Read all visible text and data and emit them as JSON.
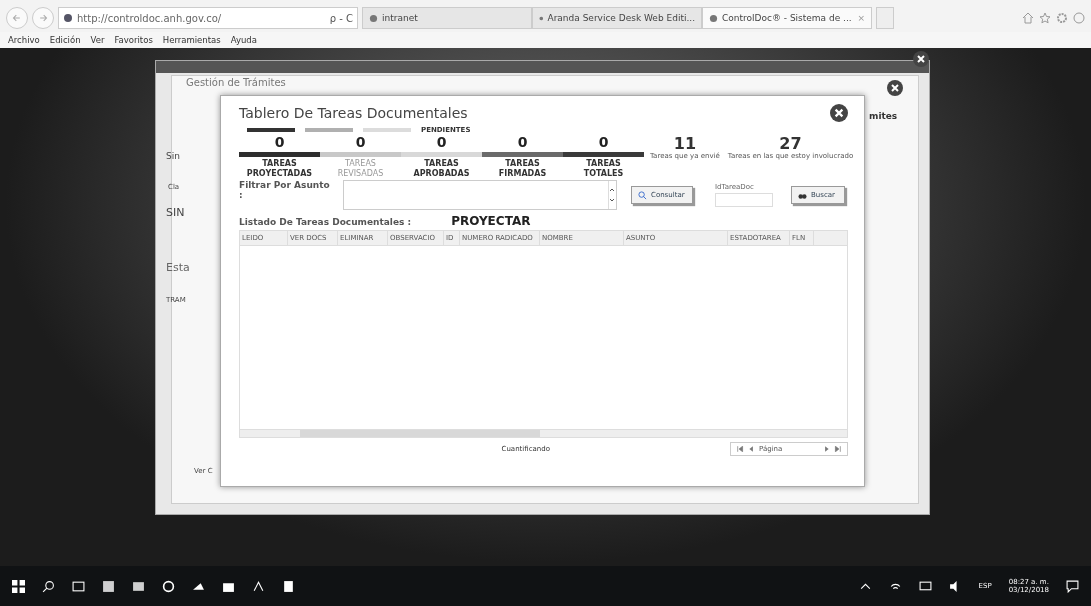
{
  "browser": {
    "address": "http://controldoc.anh.gov.co/",
    "address_actions": "ρ - C",
    "tabs": [
      {
        "label": "intranet",
        "selected": false
      },
      {
        "label": "Aranda Service Desk Web Editi...",
        "selected": false
      },
      {
        "label": "ControlDoc® - Sistema de ...",
        "selected": true,
        "close": "×"
      }
    ],
    "menu": [
      "Archivo",
      "Edición",
      "Ver",
      "Favoritos",
      "Herramientas",
      "Ayuda"
    ]
  },
  "background_page": {
    "title": "Gestión de Trámites",
    "fragments": [
      "Sin",
      "Cla",
      "SIN",
      "Esta",
      "TRAM",
      "Ver C",
      "mites"
    ]
  },
  "dialog": {
    "title": "Tablero De Tareas Documentales",
    "legend": {
      "swatches": [
        {
          "color": "#333333"
        },
        {
          "color": "#b0b0b0"
        },
        {
          "color": "#dcdcdc"
        }
      ],
      "label": "PENDIENTES"
    },
    "counters": [
      {
        "count": "0",
        "label": "TAREAS PROYECTADAS",
        "color": "#2e2e2e",
        "disabled": false
      },
      {
        "count": "0",
        "label": "TAREAS REVISADAS",
        "color": "#c8c8c8",
        "disabled": true
      },
      {
        "count": "0",
        "label": "TAREAS APROBADAS",
        "color": "#d8d8d8",
        "disabled": false
      },
      {
        "count": "0",
        "label": "TAREAS FIRMADAS",
        "color": "#6a6a6a",
        "disabled": false
      },
      {
        "count": "0",
        "label": "TAREAS TOTALES",
        "color": "#3a3a3a",
        "disabled": false
      }
    ],
    "totals": [
      {
        "count": "11",
        "caption": "Tareas que ya envié"
      },
      {
        "count": "27",
        "caption": "Tareas en las que estoy involucrado"
      }
    ],
    "filter_label": "Filtrar Por Asunto :",
    "consult_button": "Consultar",
    "id_label": "IdTareaDoc",
    "search_button": "Buscar",
    "list_label": "Listado De Tareas Documentales :",
    "list_mode": "PROYECTAR",
    "table": {
      "columns": [
        "LEIDO",
        "VER DOCS",
        "ELIMINAR",
        "OBSERVACIO",
        "ID",
        "NUMERO RADICADO",
        "NOMBRE",
        "ASUNTO",
        "ESTADOTAREA",
        "FLN"
      ]
    },
    "footer": {
      "status": "Cuantificando",
      "pager_label": "Página"
    }
  },
  "taskbar": {
    "lang": "ESP",
    "time": "08:27 a. m.",
    "date": "03/12/2018"
  }
}
